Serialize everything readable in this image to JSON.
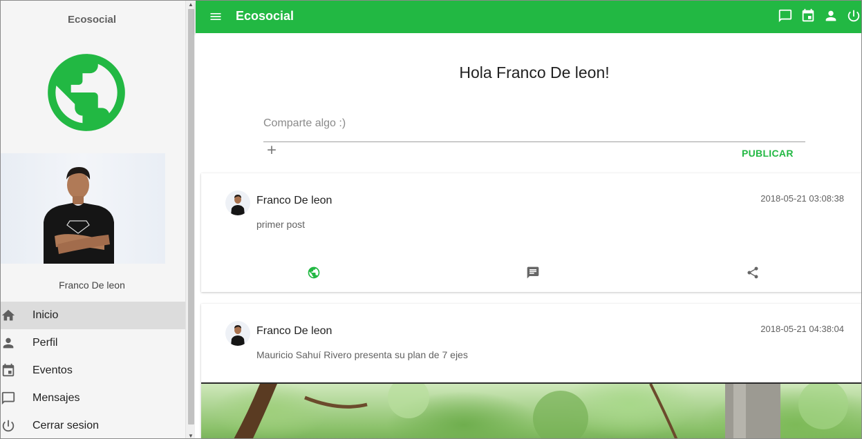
{
  "sidebar": {
    "title": "Ecosocial",
    "logo_icon": "globe-icon",
    "username": "Franco De leon",
    "nav": [
      {
        "label": "Inicio",
        "icon": "home-icon",
        "active": true
      },
      {
        "label": "Perfil",
        "icon": "person-icon",
        "active": false
      },
      {
        "label": "Eventos",
        "icon": "calendar-icon",
        "active": false
      },
      {
        "label": "Mensajes",
        "icon": "message-icon",
        "active": false
      },
      {
        "label": "Cerrar sesion",
        "icon": "power-icon",
        "active": false
      }
    ]
  },
  "topbar": {
    "title": "Ecosocial",
    "icons": [
      "menu-icon",
      "message-icon",
      "calendar-icon",
      "person-icon",
      "power-icon"
    ]
  },
  "main": {
    "greeting": "Hola Franco De leon!",
    "share_placeholder": "Comparte algo :)",
    "publish_label": "PUBLICAR"
  },
  "posts": [
    {
      "author": "Franco De leon",
      "date": "2018-05-21 03:08:38",
      "text": "primer post",
      "actions": [
        "globe-icon",
        "comment-icon",
        "share-icon"
      ]
    },
    {
      "author": "Franco De leon",
      "date": "2018-05-21 04:38:04",
      "text": "Mauricio Sahuí Rivero presenta su plan de 7 ejes"
    }
  ],
  "colors": {
    "accent": "#22b843",
    "sidebar_bg": "#f5f5f5",
    "active_item_bg": "#dcdcdc"
  }
}
